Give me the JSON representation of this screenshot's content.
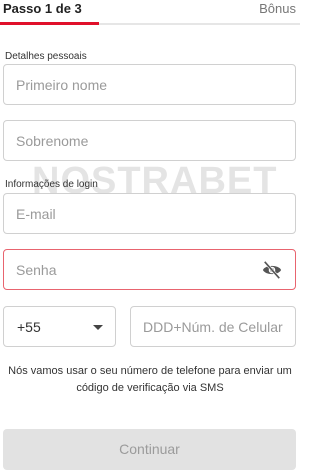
{
  "header": {
    "step": "Passo 1 de 3",
    "bonus": "Bônus",
    "progress_percent": 33,
    "accent_color": "#e0102a"
  },
  "personal": {
    "section_label": "Detalhes pessoais",
    "first_name_placeholder": "Primeiro nome",
    "last_name_placeholder": "Sobrenome"
  },
  "login": {
    "section_label": "Informações de login",
    "email_placeholder": "E-mail",
    "password_placeholder": "Senha",
    "password_toggle_icon": "eye-off-icon"
  },
  "phone": {
    "country_code": "+55",
    "number_placeholder": "DDD+Núm. de Celular",
    "note": "Nós vamos usar o seu número de telefone para enviar um código de verificação via SMS"
  },
  "watermark": "NOSTRABET",
  "continue_label": "Continuar"
}
